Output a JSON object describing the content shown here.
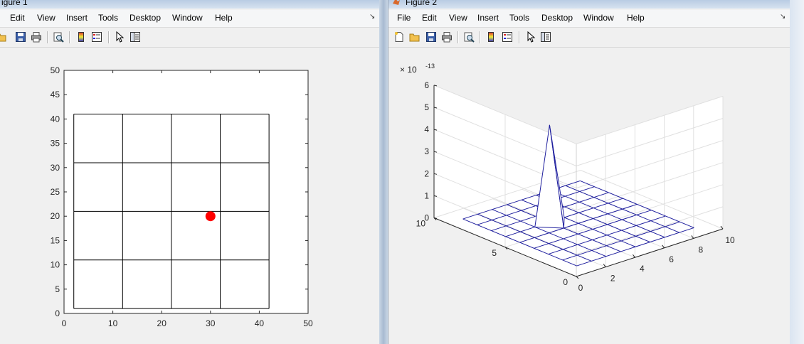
{
  "window1": {
    "title": "igure 1",
    "menu": [
      "Edit",
      "View",
      "Insert",
      "Tools",
      "Desktop",
      "Window",
      "Help"
    ],
    "toolbar_icons": [
      "open-icon",
      "save-icon",
      "print-icon",
      "print-preview-icon",
      "colorbar-icon",
      "legend-icon",
      "pointer-icon",
      "property-editor-icon"
    ]
  },
  "window2": {
    "title": "Figure 2",
    "menu": [
      "File",
      "Edit",
      "View",
      "Insert",
      "Tools",
      "Desktop",
      "Window",
      "Help"
    ],
    "toolbar_icons": [
      "new-figure-icon",
      "open-icon",
      "save-icon",
      "print-icon",
      "print-preview-icon",
      "colorbar-icon",
      "legend-icon",
      "pointer-icon",
      "property-editor-icon"
    ]
  },
  "menu_arrow": "↘",
  "chart_data": [
    {
      "type": "scatter",
      "xlim": [
        0,
        50
      ],
      "ylim": [
        0,
        50
      ],
      "xticks": [
        "0",
        "10",
        "20",
        "30",
        "40",
        "50"
      ],
      "yticks": [
        "0",
        "5",
        "10",
        "15",
        "20",
        "25",
        "30",
        "35",
        "40",
        "45",
        "50"
      ],
      "grid_lines": {
        "x": [
          2,
          12,
          22,
          32,
          42
        ],
        "y": [
          1,
          11,
          21,
          31,
          41
        ],
        "x_range": [
          2,
          42
        ],
        "y_range": [
          1,
          41
        ],
        "color": "#000000"
      },
      "points": [
        {
          "x": 30,
          "y": 20
        }
      ],
      "point_color": "#ff0000"
    },
    {
      "type": "surface",
      "x_ticks": [
        "2",
        "4",
        "6",
        "8",
        "10"
      ],
      "x_tick_values": [
        2,
        4,
        6,
        8,
        10
      ],
      "x_origin_label": "0",
      "y_ticks": [
        "0",
        "5",
        "10"
      ],
      "y_tick_values": [
        0,
        5,
        10
      ],
      "z_ticks": [
        "0",
        "1",
        "2",
        "3",
        "4",
        "5",
        "6"
      ],
      "z_tick_values": [
        0,
        1,
        2,
        3,
        4,
        5,
        6
      ],
      "z_exponent_label": "× 10",
      "z_exponent": "-13",
      "peak": {
        "x": 4,
        "y": 6,
        "z": 4.4
      },
      "mesh_color": "#1f1f9e"
    }
  ]
}
